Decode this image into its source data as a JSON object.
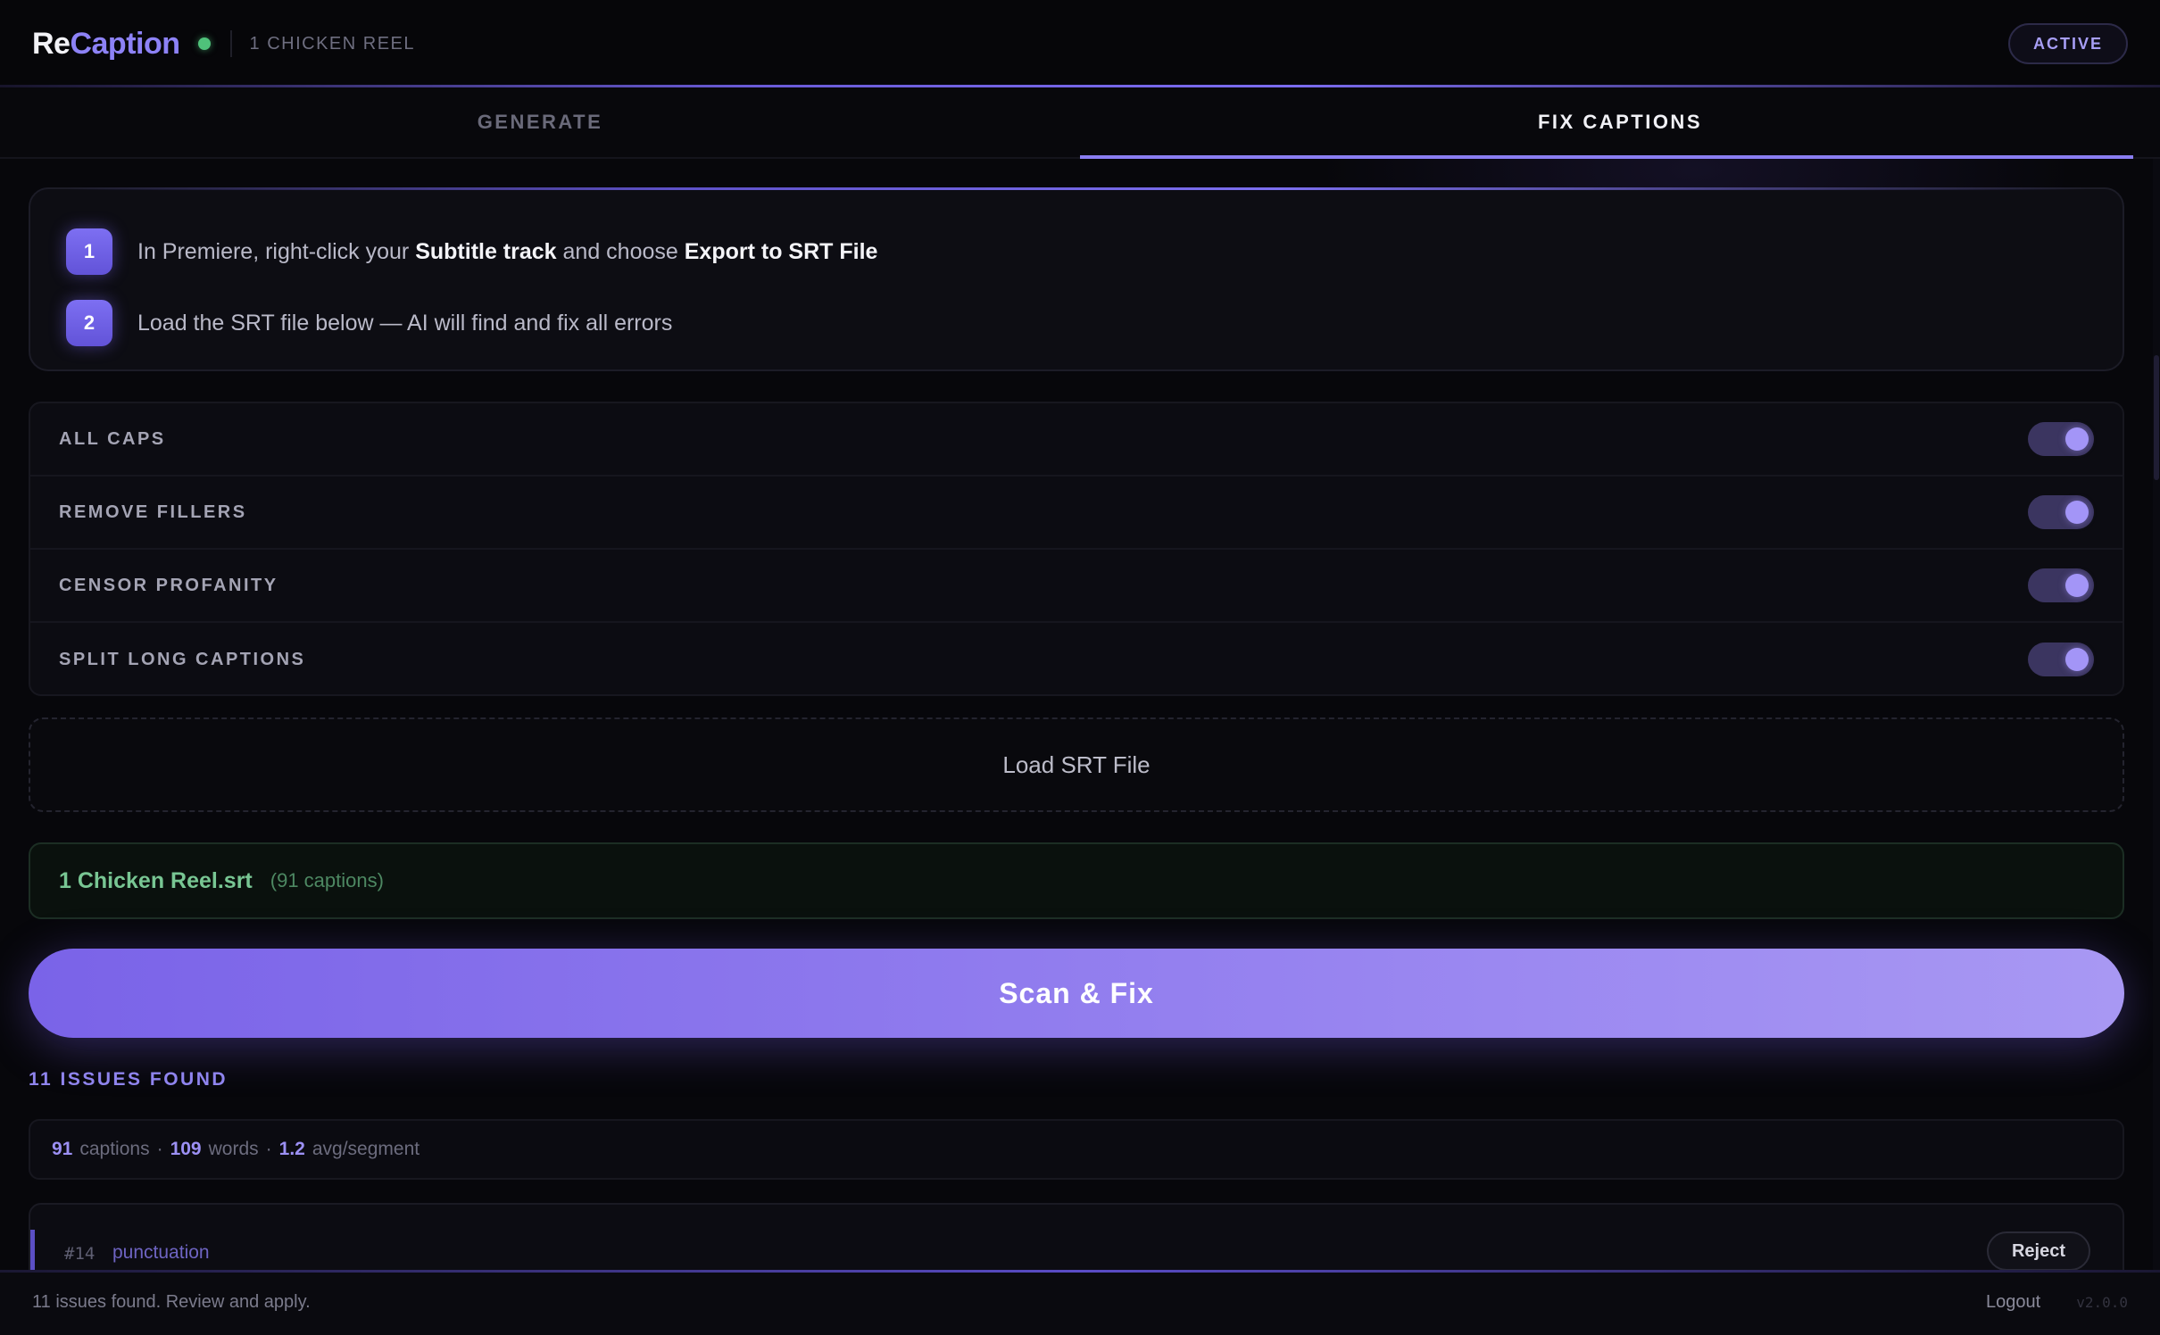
{
  "app": {
    "name_part1": "Re",
    "name_part2": "Caption",
    "project": "1 CHICKEN REEL",
    "badge": "ACTIVE"
  },
  "tabs": [
    {
      "label": "GENERATE",
      "active": false
    },
    {
      "label": "FIX CAPTIONS",
      "active": true
    }
  ],
  "steps": [
    {
      "num": "1",
      "prefix": "In Premiere, right-click your ",
      "bold1": "Subtitle track",
      "middle": " and choose ",
      "bold2": "Export to SRT File"
    },
    {
      "num": "2",
      "text": "Load the SRT file below — AI will find and fix all errors"
    }
  ],
  "options": [
    {
      "label": "ALL CAPS",
      "enabled": true
    },
    {
      "label": "REMOVE FILLERS",
      "enabled": true
    },
    {
      "label": "CENSOR PROFANITY",
      "enabled": true
    },
    {
      "label": "SPLIT LONG CAPTIONS",
      "enabled": true
    }
  ],
  "load_button": "Load SRT File",
  "file": {
    "name": "1 Chicken Reel.srt",
    "count": "(91 captions)"
  },
  "scan_button": "Scan & Fix",
  "issues_title": "11 ISSUES FOUND",
  "stats": {
    "captions": "91",
    "captions_label": "captions",
    "words": "109",
    "words_label": "words",
    "avg": "1.2",
    "avg_label": "avg/segment",
    "sep": "·"
  },
  "issue": {
    "num": "#14",
    "type": "punctuation",
    "reject": "Reject"
  },
  "footer": {
    "status": "11 issues found. Review and apply.",
    "logout": "Logout",
    "version": "v2.0.0"
  },
  "colors": {
    "accent": "#8a7df2",
    "success": "#78c693",
    "background": "#07070b"
  }
}
